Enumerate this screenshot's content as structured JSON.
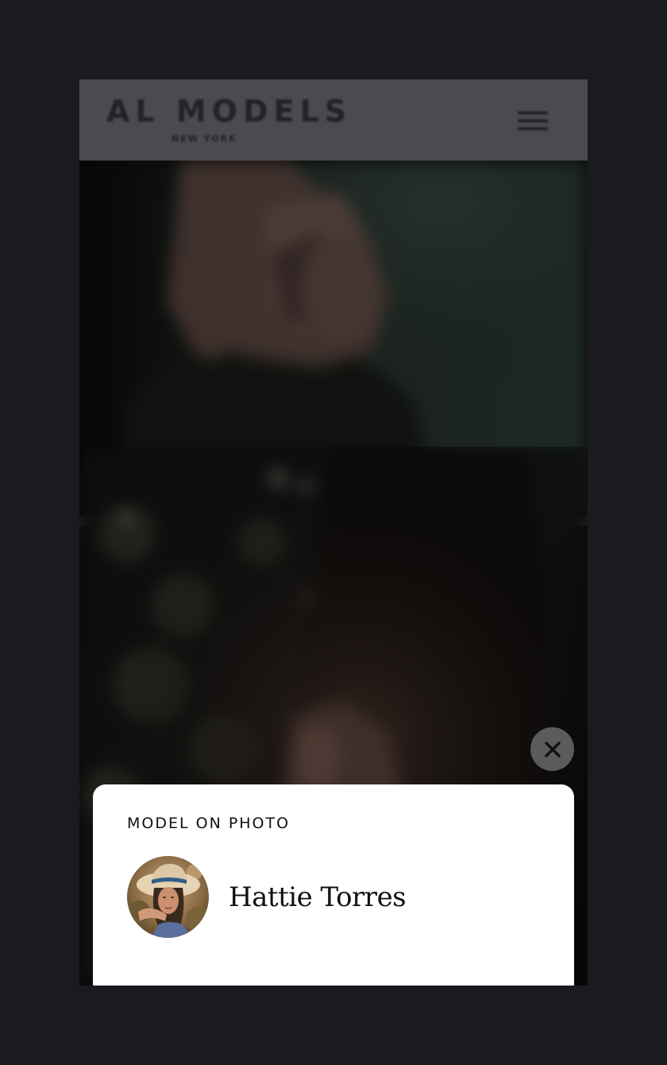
{
  "header": {
    "logo_text": "AL MODELS",
    "logo_subtext": "NEW YORK",
    "menu_icon": "hamburger-menu-icon"
  },
  "close_icon": "close-icon",
  "sheet": {
    "title": "MODEL ON PHOTO",
    "model_name": "Hattie Torres"
  },
  "colors": {
    "page_background": "#1a1b1e",
    "header_background": "#4a4b4e",
    "sheet_background": "#ffffff",
    "close_button_background": "#5a5b5d"
  }
}
